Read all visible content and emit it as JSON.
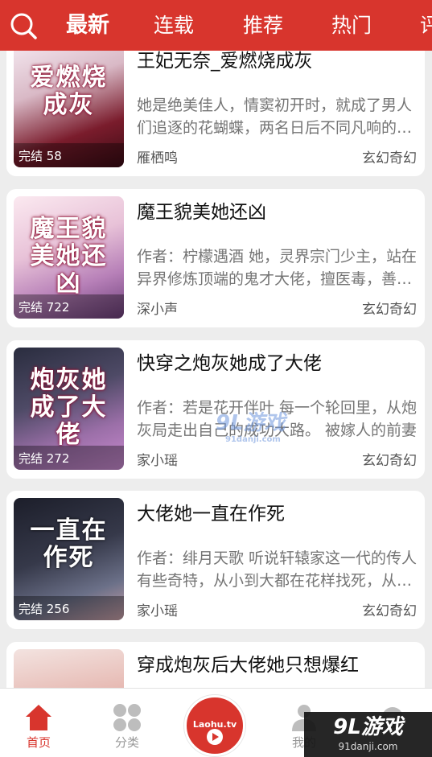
{
  "tabs": [
    {
      "label": "最新",
      "active": true
    },
    {
      "label": "连载"
    },
    {
      "label": "推荐"
    },
    {
      "label": "热门"
    },
    {
      "label": "评"
    }
  ],
  "books": [
    {
      "title": "王妃无奈_爱燃烧成灰",
      "desc": "她是绝美佳人，情窦初开时，就成了男人们追逐的花蝴蝶，两名日后不同凡响的男子",
      "author": "雁栖鸣",
      "genre": "玄幻奇幻",
      "status": "完结 58",
      "cover_text": "爱燃烧成灰"
    },
    {
      "title": "魔王貌美她还凶",
      "desc": "作者：柠檬遇酒 她，灵界宗门少主，站在异界修炼顶端的鬼才大佬，擅医毒，善布阵",
      "author": "深小声",
      "genre": "玄幻奇幻",
      "status": "完结 722",
      "cover_text": "魔王貌美她还凶"
    },
    {
      "title": "快穿之炮灰她成了大佬",
      "desc": "作者：若是花开伴叶 每一个轮回里，从炮灰局走出自己的成功大路。 被嫁人的前妻",
      "author": "家小瑶",
      "genre": "玄幻奇幻",
      "status": "完结 272",
      "cover_text": "炮灰她成了大佬"
    },
    {
      "title": "大佬她一直在作死",
      "desc": "作者：绯月天歌 听说轩辕家这一代的传人有些奇特，从小到大都在花样找死，从未成功",
      "author": "家小瑶",
      "genre": "玄幻奇幻",
      "status": "完结 256",
      "cover_text": "一直在作死"
    },
    {
      "title": "穿成炮灰后大佬她只想爆红",
      "desc": "",
      "author": "",
      "genre": "",
      "status": "",
      "cover_text": ""
    }
  ],
  "nav": [
    {
      "label": "首页",
      "icon": "home-icon",
      "active": true
    },
    {
      "label": "分类",
      "icon": "category-icon"
    },
    {
      "label": "",
      "icon": "play-icon"
    },
    {
      "label": "我的",
      "icon": "profile-icon"
    },
    {
      "label": "",
      "icon": "settings-icon"
    }
  ],
  "center_button": {
    "text": "Laohu.tv"
  },
  "watermark": {
    "main": "9L游戏",
    "sub": "91danji.com"
  },
  "watermark2": {
    "main": "9L游戏",
    "sub": "91danji.com"
  },
  "colors": {
    "brand_red": "#d8352d",
    "text_gray": "#757575"
  }
}
